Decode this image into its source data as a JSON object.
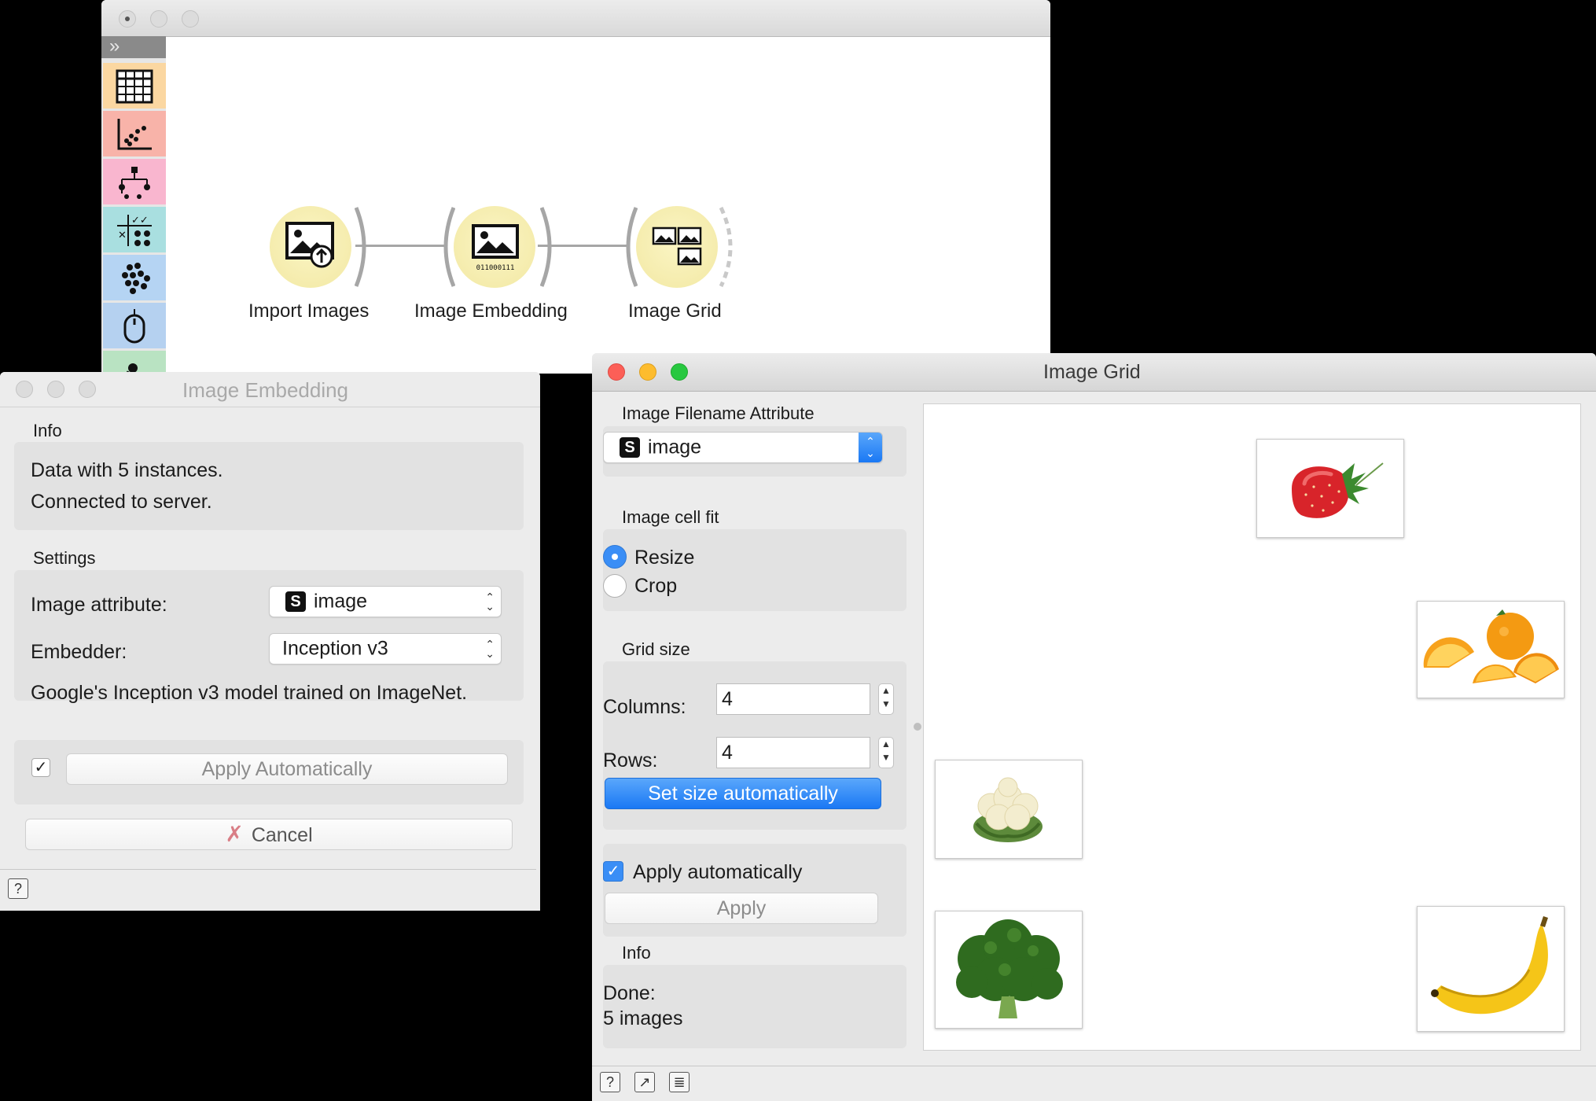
{
  "canvas": {
    "title": "",
    "nodes": [
      {
        "label": "Import Images",
        "icon": "import-images-icon"
      },
      {
        "label": "Image Embedding",
        "icon": "image-embedding-icon",
        "icon_text": "011000111"
      },
      {
        "label": "Image Grid",
        "icon": "image-grid-icon"
      }
    ],
    "toolbox": {
      "collapse_label": "»",
      "categories": [
        {
          "name": "data-category-icon",
          "color": "#fbd7a1"
        },
        {
          "name": "visualize-category-icon",
          "color": "#f8b3a9"
        },
        {
          "name": "model-category-icon",
          "color": "#f9b6cf"
        },
        {
          "name": "evaluate-category-icon",
          "color": "#a9dfe0"
        },
        {
          "name": "unsupervised-category-icon",
          "color": "#b5d4f3"
        },
        {
          "name": "mouse-category-icon",
          "color": "#b5d1f0"
        },
        {
          "name": "addon-category-icon",
          "color": "#b9e3c2"
        }
      ]
    }
  },
  "embedding": {
    "title": "Image Embedding",
    "info_label": "Info",
    "info_lines": [
      "Data with 5 instances.",
      "Connected to server."
    ],
    "settings_label": "Settings",
    "image_attribute_label": "Image attribute:",
    "image_attribute_value": "image",
    "embedder_label": "Embedder:",
    "embedder_value": "Inception v3",
    "embedder_description": "Google's Inception v3 model trained on ImageNet.",
    "apply_automatically_checked": true,
    "apply_automatically_label": "Apply Automatically",
    "cancel_label": "Cancel",
    "help_icon": "?"
  },
  "grid": {
    "title": "Image Grid",
    "filename_attr_label": "Image Filename Attribute",
    "filename_attr_value": "image",
    "cell_fit_label": "Image cell fit",
    "cell_fit_options": [
      "Resize",
      "Crop"
    ],
    "cell_fit_selected": "Resize",
    "grid_size_label": "Grid size",
    "columns_label": "Columns:",
    "columns_value": "4",
    "rows_label": "Rows:",
    "rows_value": "4",
    "set_size_label": "Set size automatically",
    "apply_auto_label": "Apply automatically",
    "apply_auto_checked": true,
    "apply_label": "Apply",
    "info_label": "Info",
    "info_lines": [
      "Done:",
      "5 images"
    ],
    "images": [
      "strawberry",
      "orange",
      "cauliflower",
      "broccoli",
      "banana"
    ],
    "status_icons": [
      "help-icon",
      "report-icon",
      "save-image-icon"
    ]
  }
}
